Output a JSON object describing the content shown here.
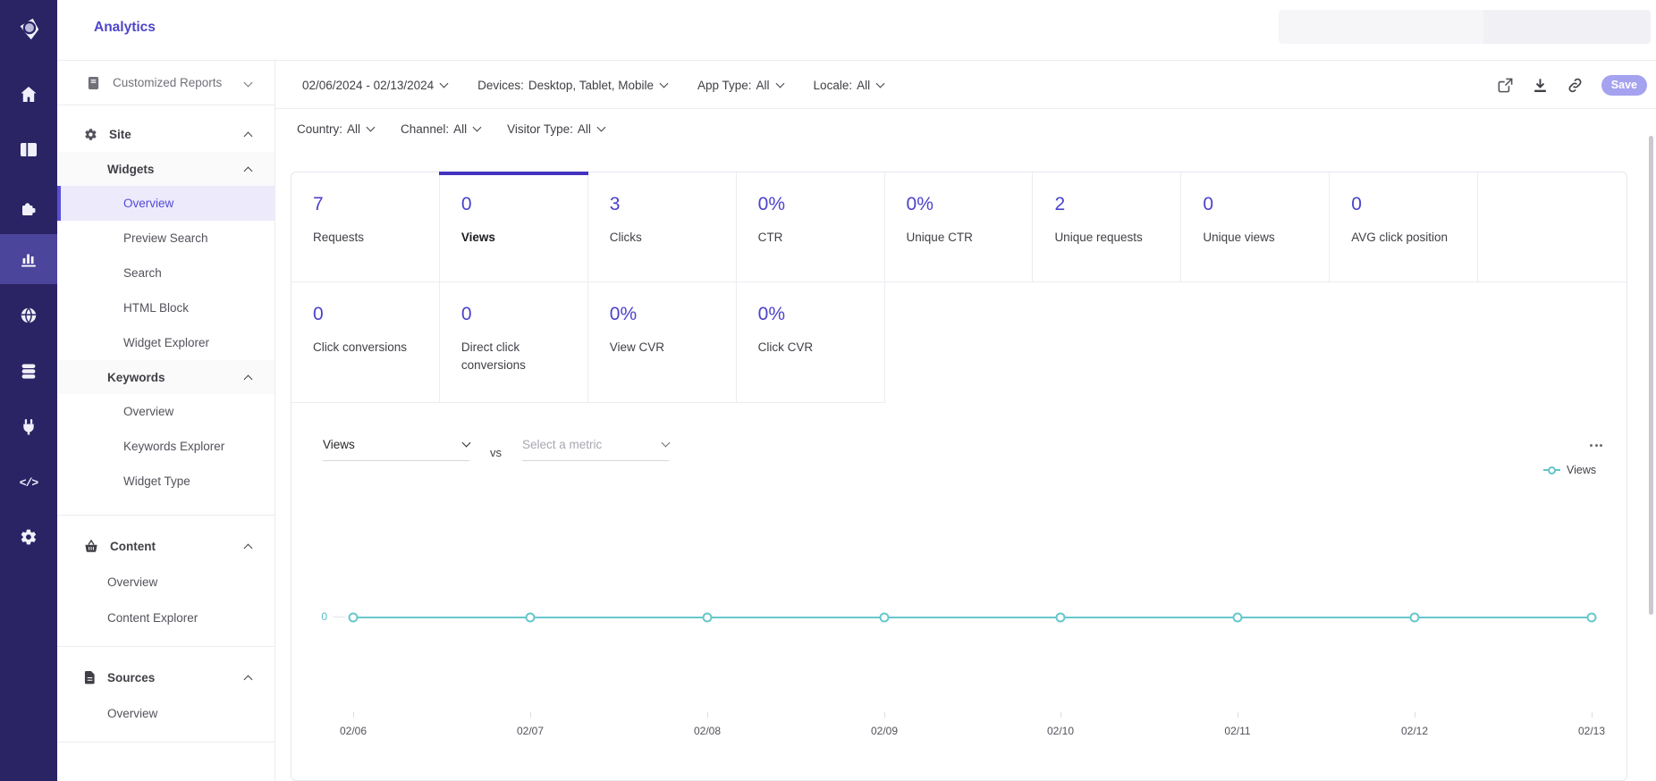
{
  "app": {
    "title": "Analytics",
    "accent_color": "#4f45c9"
  },
  "toolbar": {
    "date_range": "02/06/2024 - 02/13/2024",
    "save_label": "Save",
    "icons": [
      "share-icon",
      "download-icon",
      "link-icon"
    ]
  },
  "filters": {
    "row1": [
      {
        "label": "Devices:",
        "value": "Desktop, Tablet, Mobile"
      },
      {
        "label": "App Type:",
        "value": "All"
      },
      {
        "label": "Locale:",
        "value": "All"
      }
    ],
    "row2": [
      {
        "label": "Country:",
        "value": "All"
      },
      {
        "label": "Channel:",
        "value": "All"
      },
      {
        "label": "Visitor Type:",
        "value": "All"
      }
    ]
  },
  "sidebar": {
    "report_selector": "Customized Reports",
    "site_title": "Site",
    "widgets": {
      "title": "Widgets",
      "items": [
        "Overview",
        "Preview Search",
        "Search",
        "HTML Block",
        "Widget Explorer"
      ]
    },
    "keywords": {
      "title": "Keywords",
      "items": [
        "Overview",
        "Keywords Explorer",
        "Widget Type"
      ]
    },
    "content": {
      "title": "Content",
      "items": [
        "Overview",
        "Content Explorer"
      ]
    },
    "sources": {
      "title": "Sources",
      "items": [
        "Overview"
      ]
    }
  },
  "cards": {
    "row1": [
      {
        "value": "7",
        "label": "Requests"
      },
      {
        "value": "0",
        "label": "Views",
        "selected": true
      },
      {
        "value": "3",
        "label": "Clicks"
      },
      {
        "value": "0%",
        "label": "CTR"
      },
      {
        "value": "0%",
        "label": "Unique CTR"
      },
      {
        "value": "2",
        "label": "Unique requests"
      },
      {
        "value": "0",
        "label": "Unique views"
      },
      {
        "value": "0",
        "label": "AVG click position"
      }
    ],
    "row2": [
      {
        "value": "0",
        "label": "Click conversions"
      },
      {
        "value": "0",
        "label": "Direct click conversions"
      },
      {
        "value": "0%",
        "label": "View CVR"
      },
      {
        "value": "0%",
        "label": "Click CVR"
      }
    ]
  },
  "chart_controls": {
    "primary_metric": "Views",
    "vs_label": "vs",
    "compare_placeholder": "Select a metric"
  },
  "chart_data": {
    "type": "line",
    "x": [
      "02/06",
      "02/07",
      "02/08",
      "02/09",
      "02/10",
      "02/11",
      "02/12",
      "02/13"
    ],
    "series": [
      {
        "name": "Views",
        "values": [
          0,
          0,
          0,
          0,
          0,
          0,
          0,
          0
        ],
        "color": "#62c4ca"
      }
    ],
    "y_ticks": [
      "0"
    ],
    "ylim": [
      0,
      1
    ],
    "grid": false,
    "legend_position": "top-right"
  }
}
